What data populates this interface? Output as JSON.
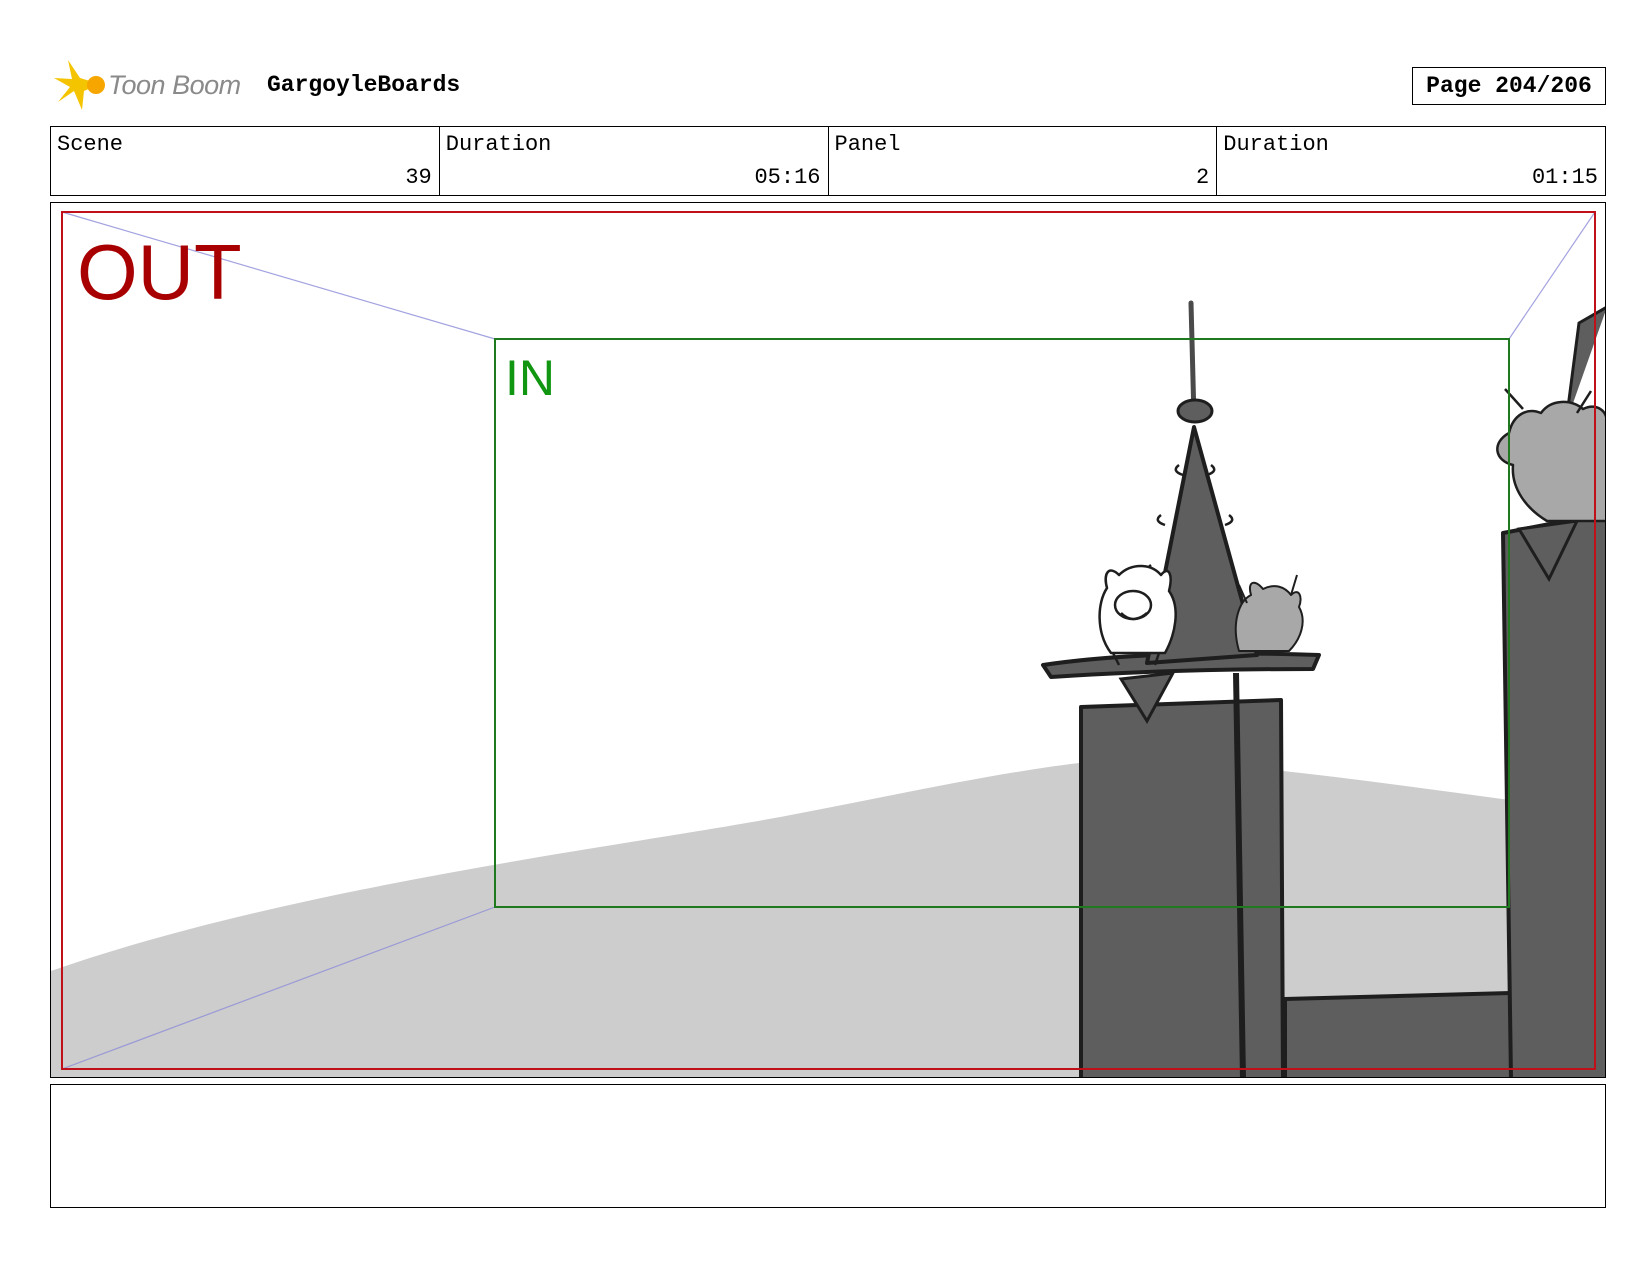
{
  "header": {
    "logo_text": "Toon Boom",
    "project_title": "GargoyleBoards",
    "page_indicator": "Page 204/206"
  },
  "info": {
    "scene_label": "Scene",
    "scene_value": "39",
    "scene_duration_label": "Duration",
    "scene_duration_value": "05:16",
    "panel_label": "Panel",
    "panel_value": "2",
    "panel_duration_label": "Duration",
    "panel_duration_value": "01:15"
  },
  "panel": {
    "out_label": "OUT",
    "in_label": "IN"
  },
  "colors": {
    "out_frame": "#c0101a",
    "in_frame": "#1f7a1f",
    "perspective_lines": "#8c8cd8",
    "ground": "#cdcdcd",
    "tower": "#5e5e5e",
    "outline": "#1e1e1e"
  }
}
